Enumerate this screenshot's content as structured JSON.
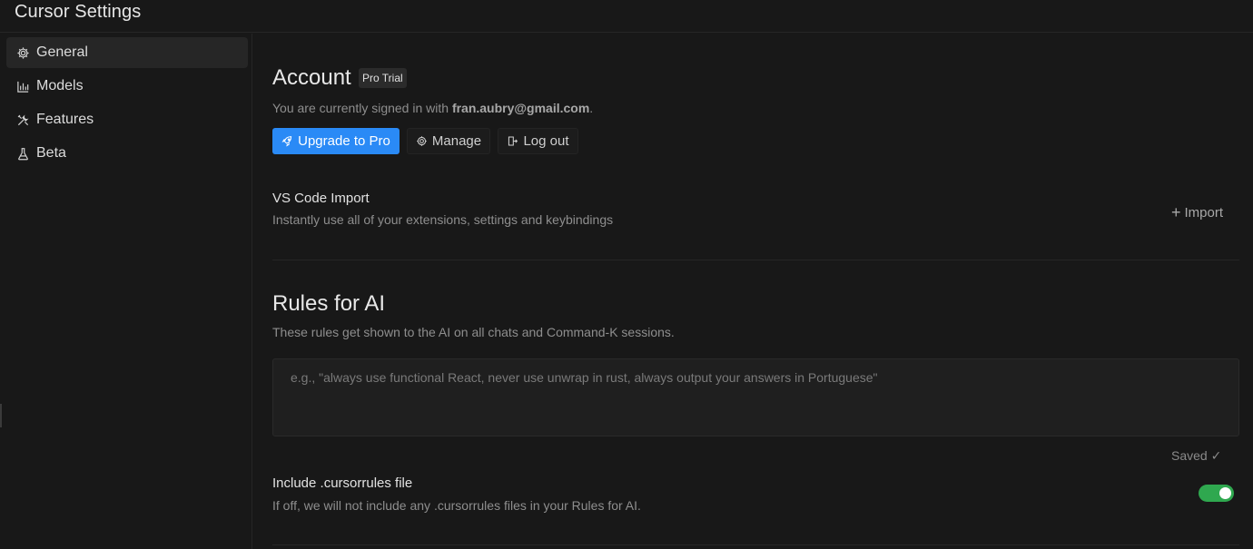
{
  "window": {
    "title": "Cursor Settings"
  },
  "sidebar": {
    "items": [
      {
        "label": "General",
        "icon": "gear-icon",
        "active": true
      },
      {
        "label": "Models",
        "icon": "bar-chart-icon",
        "active": false
      },
      {
        "label": "Features",
        "icon": "tools-icon",
        "active": false
      },
      {
        "label": "Beta",
        "icon": "flask-icon",
        "active": false
      }
    ]
  },
  "account": {
    "heading": "Account",
    "badge": "Pro Trial",
    "signed_in_prefix": "You are currently signed in with ",
    "email": "fran.aubry@gmail.com",
    "signed_in_suffix": ".",
    "upgrade_label": "Upgrade to Pro",
    "manage_label": "Manage",
    "logout_label": "Log out"
  },
  "vscode_import": {
    "title": "VS Code Import",
    "description": "Instantly use all of your extensions, settings and keybindings",
    "import_label": "Import"
  },
  "rules": {
    "heading": "Rules for AI",
    "description": "These rules get shown to the AI on all chats and Command-K sessions.",
    "placeholder": "e.g., \"always use functional React, never use unwrap in rust, always output your answers in Portuguese\"",
    "value": "",
    "saved_label": "Saved ✓"
  },
  "cursorrules": {
    "title": "Include .cursorrules file",
    "description": "If off, we will not include any .cursorrules files in your Rules for AI.",
    "enabled": true
  },
  "colors": {
    "background": "#181818",
    "accent": "#2a8af6",
    "toggle_on": "#2fa84f"
  }
}
